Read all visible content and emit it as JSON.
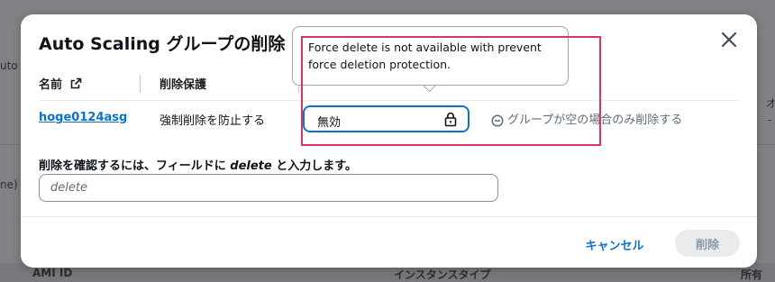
{
  "background": {
    "left_fragments": [
      "uto",
      "ne)"
    ],
    "right_fragments": [
      "オ",
      "-"
    ],
    "footer_left": "AMI ID",
    "footer_mid": "インスタンスタイプ",
    "footer_right": "所有"
  },
  "dialog": {
    "title": "Auto Scaling グループの削除",
    "columns": {
      "name": "名前",
      "protection": "削除保護",
      "force": ""
    },
    "row": {
      "name": "hoge0124asg",
      "protection": "強制削除を防止する",
      "select_value": "無効",
      "option_label": "グループが空の場合のみ削除する"
    },
    "confirm": {
      "label_prefix": "削除を確認するには、フィールドに ",
      "label_keyword": "delete",
      "label_suffix": " と入力します。",
      "placeholder": "delete"
    },
    "buttons": {
      "cancel": "キャンセル",
      "delete": "削除"
    }
  },
  "tooltip": {
    "text": "Force delete is not available with prevent force deletion protection."
  },
  "colors": {
    "link": "#0972d3",
    "highlight": "#e0306a",
    "disabled_button": "#e9ebed"
  }
}
